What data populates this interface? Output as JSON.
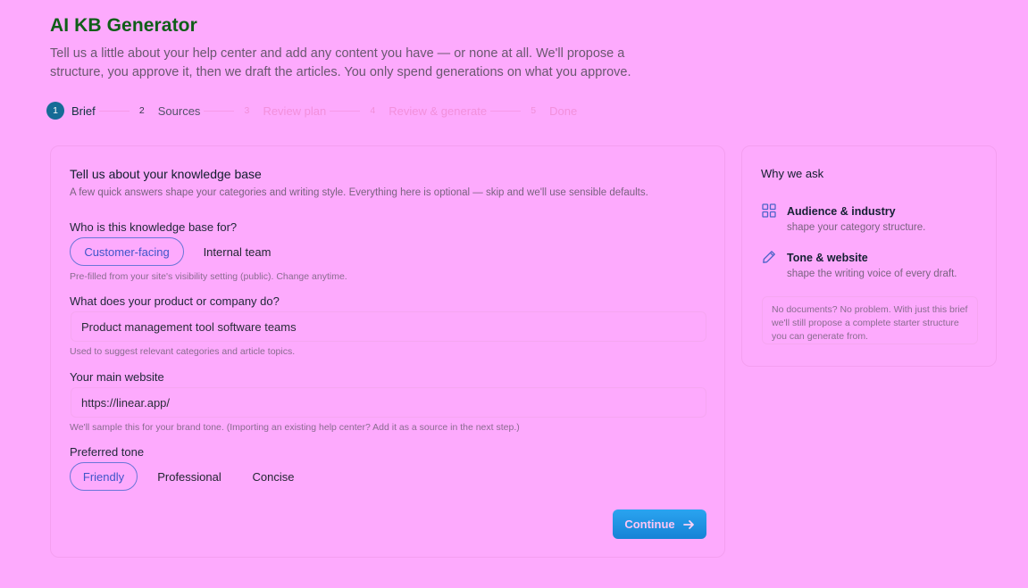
{
  "header": {
    "title": "AI KB Generator",
    "intro": "Tell us a little about your help center and add any content you have — or none at all. We'll propose a structure, you approve it, then we draft the articles. You only spend generations on what you approve."
  },
  "stepper": [
    {
      "num": "1",
      "label": "Brief",
      "state": "active"
    },
    {
      "num": "2",
      "label": "Sources",
      "state": "next"
    },
    {
      "num": "3",
      "label": "Review plan",
      "state": "future"
    },
    {
      "num": "4",
      "label": "Review & generate",
      "state": "future"
    },
    {
      "num": "5",
      "label": "Done",
      "state": "future"
    }
  ],
  "brief": {
    "heading": "Tell us about your knowledge base",
    "subheading": "A few quick answers shape your categories and writing style. Everything here is optional — skip and we'll use sensible defaults.",
    "audience": {
      "label": "Who is this knowledge base for?",
      "options": [
        "Customer-facing",
        "Internal team"
      ],
      "selected": "Customer-facing",
      "hint": "Pre-filled from your site's visibility setting (public). Change anytime."
    },
    "product": {
      "label": "What does your product or company do?",
      "value": "Product management tool software teams",
      "hint": "Used to suggest relevant categories and article topics."
    },
    "website": {
      "label": "Your main website",
      "value": "https://linear.app/",
      "hint": "We'll sample this for your brand tone. (Importing an existing help center? Add it as a source in the next step.)"
    },
    "tone": {
      "label": "Preferred tone",
      "options": [
        "Friendly",
        "Professional",
        "Concise"
      ],
      "selected": "Friendly"
    },
    "continue_label": "Continue"
  },
  "why": {
    "heading": "Why we ask",
    "items": [
      {
        "icon": "grid-icon",
        "title": "Audience & industry",
        "desc": "shape your category structure."
      },
      {
        "icon": "pencil-icon",
        "title": "Tone & website",
        "desc": "shape the writing voice of every draft."
      }
    ],
    "note": "No documents? No problem. With just this brief we'll still propose a complete starter structure you can generate from."
  },
  "colors": {
    "background": "#fdaafd",
    "title": "#0f5e18",
    "accent": "#166b96",
    "selected_chip_border": "#6a76d8",
    "cta_gradient_top": "#2aa4f0",
    "cta_gradient_bottom": "#1683d6"
  }
}
